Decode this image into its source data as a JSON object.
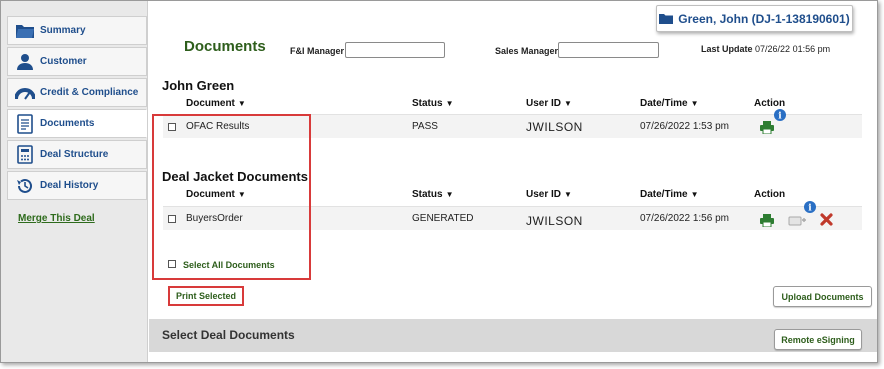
{
  "sidebar": {
    "items": [
      {
        "label": "Summary",
        "icon": "folder-icon"
      },
      {
        "label": "Customer",
        "icon": "person-icon"
      },
      {
        "label": "Credit & Compliance",
        "icon": "gauge-icon"
      },
      {
        "label": "Documents",
        "icon": "document-icon"
      },
      {
        "label": "Deal Structure",
        "icon": "calculator-icon"
      },
      {
        "label": "Deal History",
        "icon": "history-icon"
      }
    ],
    "active": "Documents",
    "merge_link": "Merge This Deal"
  },
  "header": {
    "customer_button": "Green, John (DJ-1-138190601)",
    "page_title": "Documents",
    "fi_manager_label": "F&I Manager",
    "fi_manager_value": "",
    "sales_manager_label": "Sales Manager",
    "sales_manager_value": "",
    "last_update_label": "Last Update",
    "last_update_value": "07/26/22 01:56 pm"
  },
  "columns": {
    "document": "Document",
    "status": "Status",
    "user_id": "User ID",
    "date_time": "Date/Time",
    "action": "Action"
  },
  "customer_section": {
    "title": "John Green",
    "rows": [
      {
        "document": "OFAC Results",
        "status": "PASS",
        "user_id": "JWILSON",
        "date_time": "07/26/2022 1:53 pm"
      }
    ]
  },
  "deal_jacket_section": {
    "title": "Deal Jacket Documents",
    "rows": [
      {
        "document": "BuyersOrder",
        "status": "GENERATED",
        "user_id": "JWILSON",
        "date_time": "07/26/2022 1:56 pm"
      }
    ]
  },
  "select_all_label": "Select All Documents",
  "print_selected_label": "Print Selected",
  "upload_documents_label": "Upload Documents",
  "select_deal_documents_title": "Select Deal Documents",
  "remote_esigning_label": "Remote eSigning",
  "colors": {
    "brand_blue": "#1f4e8c",
    "brand_green": "#2e5e1c",
    "highlight_red": "#d83a3a",
    "info_blue": "#2a6fc4",
    "delete_red": "#c0392b"
  }
}
